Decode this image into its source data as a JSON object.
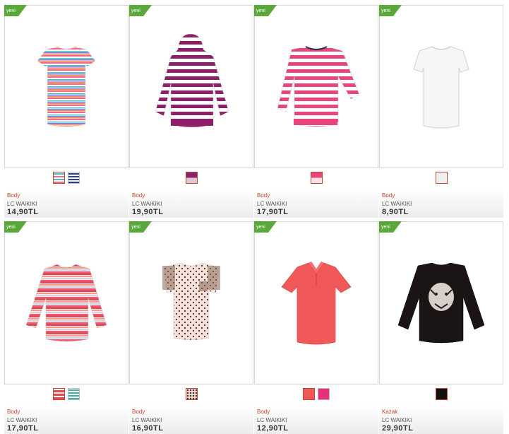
{
  "badge_label": "yeni",
  "colors": {
    "accent": "#c0482e",
    "ribbon": "#5aa83a"
  },
  "products": [
    {
      "category": "Body",
      "brand": "LC WAIKIKI",
      "price": "14,90TL",
      "item": "striped-short-sleeve-top",
      "swatches": [
        "multistripe",
        "bluestripe"
      ]
    },
    {
      "category": "Body",
      "brand": "LC WAIKIKI",
      "price": "19,90TL",
      "item": "striped-hoodie",
      "swatches": [
        "purple"
      ]
    },
    {
      "category": "Body",
      "brand": "LC WAIKIKI",
      "price": "17,90TL",
      "item": "pink-striped-henley",
      "swatches": [
        "pink"
      ]
    },
    {
      "category": "Body",
      "brand": "LC WAIKIKI",
      "price": "8,90TL",
      "item": "white-tshirt",
      "swatches": [
        "white"
      ]
    },
    {
      "category": "Body",
      "brand": "LC WAIKIKI",
      "price": "17,90TL",
      "item": "striped-long-sleeve-sweater",
      "swatches": [
        "redstripe",
        "tealstripe"
      ]
    },
    {
      "category": "Body",
      "brand": "LC WAIKIKI",
      "price": "16,90TL",
      "item": "polka-dot-top",
      "swatches": [
        "dots"
      ]
    },
    {
      "category": "Body",
      "brand": "LC WAIKIKI",
      "price": "12,90TL",
      "item": "coral-polo-shirt",
      "swatches": [
        "coral",
        "hotpink"
      ]
    },
    {
      "category": "Kazak",
      "brand": "LC WAIKIKI",
      "price": "29,90TL",
      "item": "black-tiger-sweater",
      "swatches": [
        "black"
      ]
    }
  ]
}
